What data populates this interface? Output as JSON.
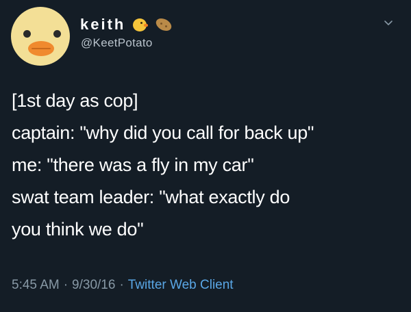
{
  "user": {
    "display_name": "keith",
    "handle": "@KeetPotato",
    "name_emojis": [
      "chick-emoji-icon",
      "potato-emoji-icon"
    ]
  },
  "tweet": {
    "lines": [
      "[1st day as cop]",
      "captain: \"why did you call for back up\"",
      "me: \"there was a fly in my car\"",
      "swat team leader: \"what exactly do",
      "you think we do\""
    ],
    "time": "5:45 AM",
    "separator": "·",
    "date": "9/30/16",
    "client": "Twitter Web Client"
  },
  "colors": {
    "background": "#141d26",
    "text": "#ffffff",
    "muted": "#8899a6",
    "link": "#5aa7e6"
  }
}
